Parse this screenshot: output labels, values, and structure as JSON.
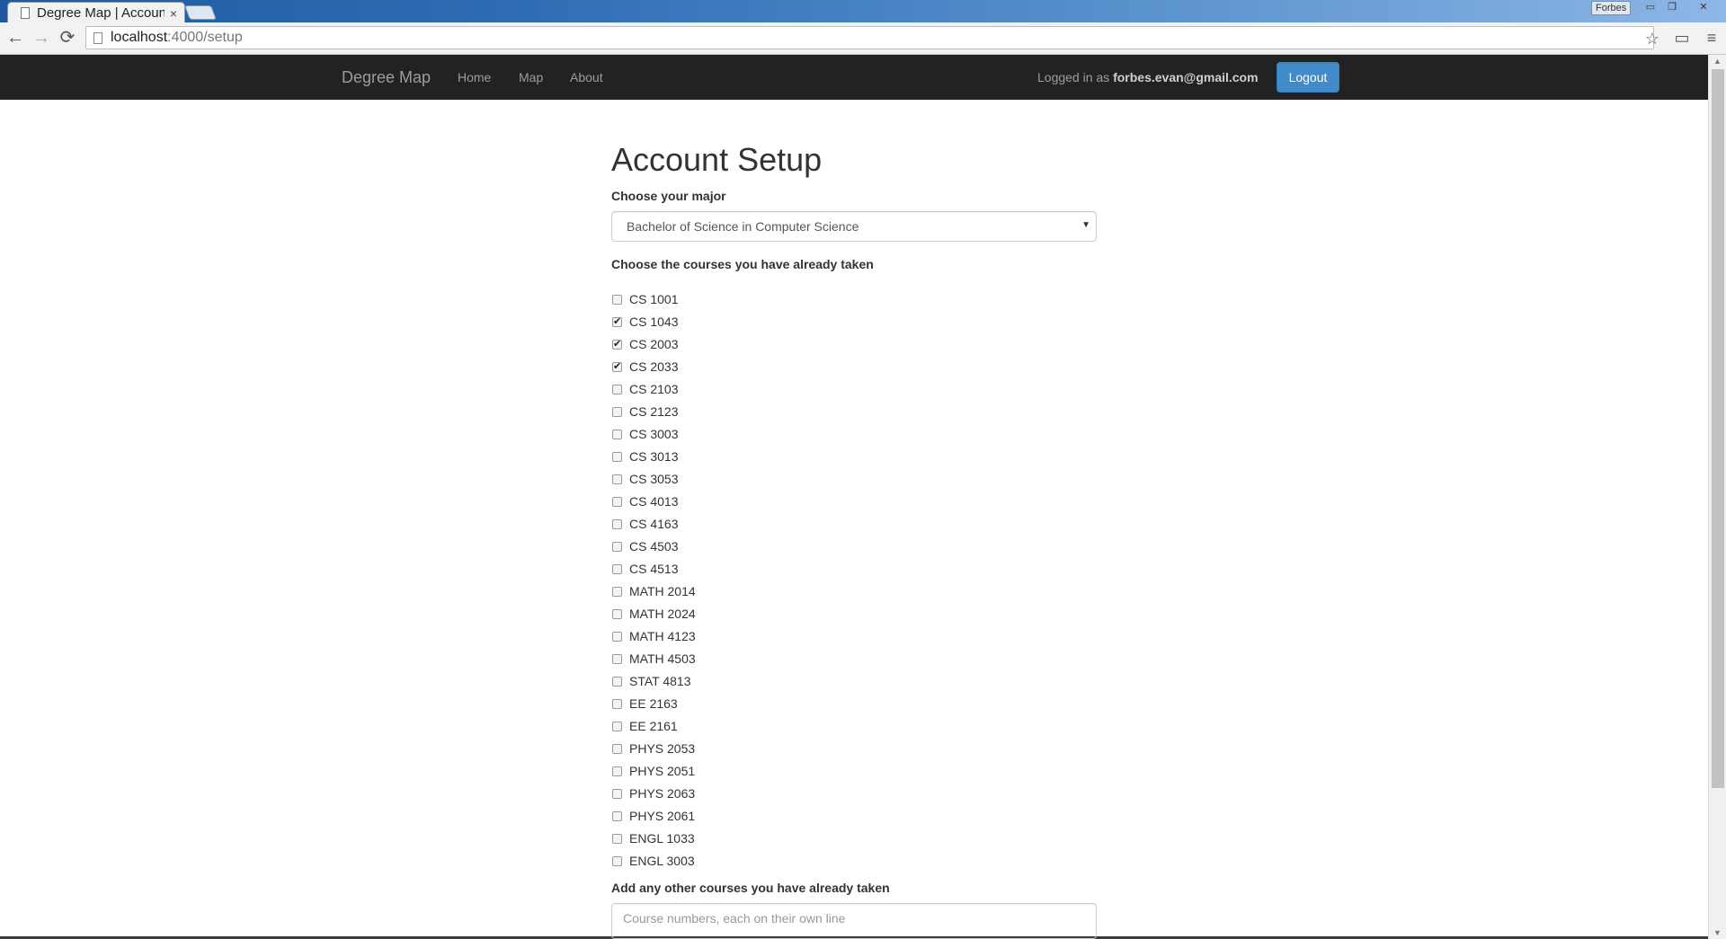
{
  "browser": {
    "tab_title": "Degree Map | Account Setup",
    "tab_close": "×",
    "profile_name": "Forbes",
    "window_controls": {
      "minimize": "▭",
      "restore": "❐",
      "close": "✕"
    },
    "nav": {
      "back": "←",
      "forward": "→",
      "reload": "⟳"
    },
    "url_host": "localhost",
    "url_path": ":4000/setup",
    "icons": {
      "bookmark": "☆",
      "cast": "▭",
      "menu": "≡"
    }
  },
  "app_nav": {
    "brand": "Degree Map",
    "links": [
      "Home",
      "Map",
      "About"
    ],
    "logged_in_prefix": "Logged in as ",
    "user_email": "forbes.evan@gmail.com",
    "logout_label": "Logout",
    "logout_color": "#428bca"
  },
  "page": {
    "title": "Account Setup",
    "major_label": "Choose your major",
    "major_selected": "Bachelor of Science in Computer Science",
    "courses_label": "Choose the courses you have already taken",
    "courses": [
      {
        "code": "CS 1001",
        "checked": false
      },
      {
        "code": "CS 1043",
        "checked": true
      },
      {
        "code": "CS 2003",
        "checked": true
      },
      {
        "code": "CS 2033",
        "checked": true
      },
      {
        "code": "CS 2103",
        "checked": false
      },
      {
        "code": "CS 2123",
        "checked": false
      },
      {
        "code": "CS 3003",
        "checked": false
      },
      {
        "code": "CS 3013",
        "checked": false
      },
      {
        "code": "CS 3053",
        "checked": false
      },
      {
        "code": "CS 4013",
        "checked": false
      },
      {
        "code": "CS 4163",
        "checked": false
      },
      {
        "code": "CS 4503",
        "checked": false
      },
      {
        "code": "CS 4513",
        "checked": false
      },
      {
        "code": "MATH 2014",
        "checked": false
      },
      {
        "code": "MATH 2024",
        "checked": false
      },
      {
        "code": "MATH 4123",
        "checked": false
      },
      {
        "code": "MATH 4503",
        "checked": false
      },
      {
        "code": "STAT 4813",
        "checked": false
      },
      {
        "code": "EE 2163",
        "checked": false
      },
      {
        "code": "EE 2161",
        "checked": false
      },
      {
        "code": "PHYS 2053",
        "checked": false
      },
      {
        "code": "PHYS 2051",
        "checked": false
      },
      {
        "code": "PHYS 2063",
        "checked": false
      },
      {
        "code": "PHYS 2061",
        "checked": false
      },
      {
        "code": "ENGL 1033",
        "checked": false
      },
      {
        "code": "ENGL 3003",
        "checked": false
      }
    ],
    "other_label": "Add any other courses you have already taken",
    "other_placeholder": "Course numbers, each on their own line"
  }
}
